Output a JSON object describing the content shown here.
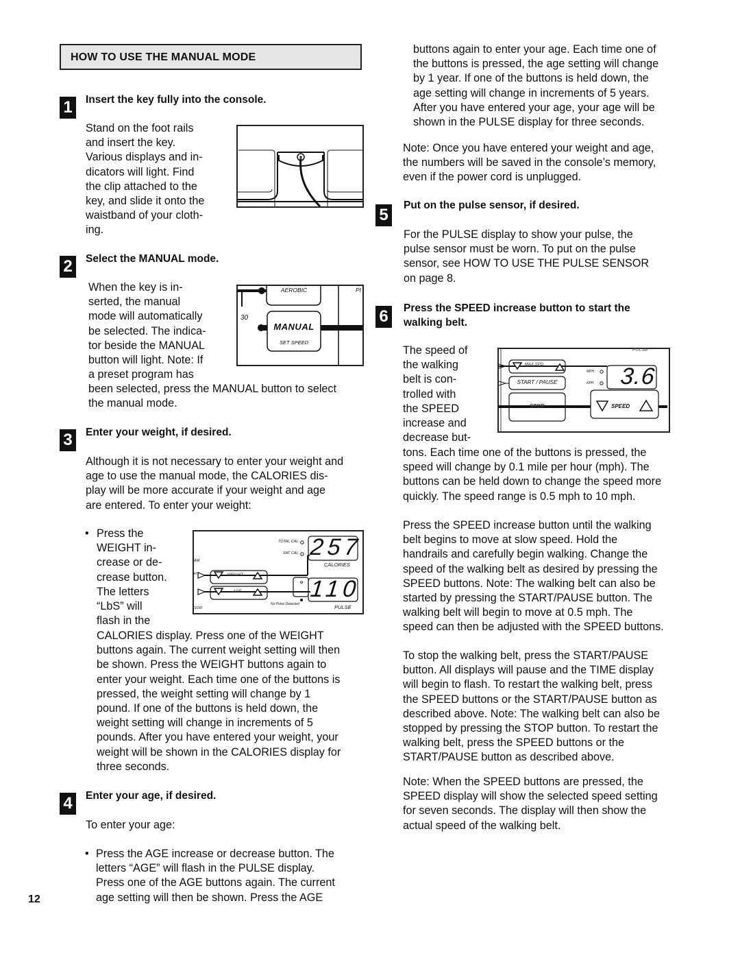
{
  "section": {
    "title": "HOW TO USE THE MANUAL MODE"
  },
  "page_number": "12",
  "steps": [
    {
      "number": "1",
      "title": "Insert the key fully into the console.",
      "body": "Stand on the foot rails\nand insert the key.\nVarious displays and in-\ndicators will light. Find\nthe clip attached to the\nkey, and slide it onto the\nwaistband of your cloth-\ning."
    },
    {
      "number": "2",
      "title": "Select the MANUAL mode.",
      "body_wrapped": "When the key is in-\nserted, the manual\nmode will automatically\nbe selected. The indica-\ntor beside the MANUAL\nbutton will light. Note: If\na preset program has",
      "body_full": "been selected, press the MANUAL button to select\nthe manual mode."
    },
    {
      "number": "3",
      "title": "Enter your weight, if desired.",
      "intro": "Although it is not necessary to enter your weight and\nage to use the manual mode, the CALORIES dis-\nplay will be more accurate if your weight and age\nare entered. To enter your weight:",
      "bullet_wrapped": "Press the\nWEIGHT in-\ncrease or de-\ncrease button.\nThe letters\n“LbS” will\nflash in the",
      "bullet_full": "CALORIES display. Press one of the WEIGHT\nbuttons again. The current weight setting will then\nbe shown. Press the WEIGHT buttons again to\nenter your weight. Each time one of the buttons is\npressed, the weight setting will change by 1\npound. If one of the buttons is held down, the\nweight setting will change in increments of 5\npounds. After you have entered your weight, your\nweight will be shown in the CALORIES display for\nthree seconds."
    },
    {
      "number": "4",
      "title": "Enter your age, if desired.",
      "intro": "To enter your age:",
      "bullet": "Press the AGE increase or decrease button. The\nletters “AGE” will flash in the PULSE display.\nPress one of the AGE buttons again. The current\nage setting will then be shown. Press the AGE",
      "continued": "buttons again to enter your age. Each time one of\nthe buttons is pressed, the age setting will change\nby 1 year. If one of the buttons is held down, the\nage setting will change in increments of 5 years.\nAfter you have entered your age, your age will be\nshown in the PULSE display for three seconds.",
      "note": "Note: Once you have entered your weight and age,\nthe numbers will be saved in the console’s memory,\neven if the power cord is unplugged."
    },
    {
      "number": "5",
      "title": "Put on the pulse sensor, if desired.",
      "body": "For the PULSE display to show your pulse, the\npulse sensor must be worn. To put on the pulse\nsensor, see HOW TO USE THE PULSE SENSOR\non page 8."
    },
    {
      "number": "6",
      "title": "Press the SPEED increase button to start the\nwalking belt.",
      "body_wrapped": "The speed of\nthe walking\nbelt is con-\ntrolled with\nthe SPEED\nincrease and\ndecrease but-",
      "body_full": "tons. Each time one of the buttons is pressed, the\nspeed will change by 0.1 mile per hour (mph). The\nbuttons can be held down to change the speed more\nquickly. The speed range is 0.5 mph to 10 mph.",
      "para2": "Press the SPEED increase button until the walking\nbelt begins to move at slow speed. Hold the\nhandrails and carefully begin walking. Change the\nspeed of the walking belt as desired by pressing the\nSPEED buttons. Note: The walking belt can also be\nstarted by pressing the START/PAUSE button. The\nwalking belt will begin to move at 0.5 mph. The\nspeed can then be adjusted with the SPEED buttons.",
      "para3": "To stop the walking belt, press the START/PAUSE\nbutton. All displays will pause and the TIME display\nwill begin to flash. To restart the walking belt, press\nthe SPEED buttons or the START/PAUSE button as\ndescribed above. Note: The walking belt can also be\nstopped by pressing the STOP button. To restart the\nwalking belt, press the SPEED buttons or the\nSTART/PAUSE button as described above.",
      "para4": "Note: When the SPEED buttons are pressed, the\nSPEED display will show the selected speed setting\nfor seven seconds. The display will then show the\nactual speed of the walking belt."
    }
  ],
  "figures": {
    "manual_panel": {
      "aerobic_label": "AEROBIC",
      "partial_label": "PI",
      "level_label": "30",
      "manual_label": "MANUAL",
      "sub_label": "SET SPEED"
    },
    "calories_panel": {
      "total_cal_label": "TOTAL CAL.",
      "fat_cal_label": "FAT CAL.",
      "calories_value": "257",
      "calories_label": "CALORIES",
      "weight_label": "WEIGHT",
      "age_label": "AGE",
      "pulse_value": "110",
      "pulse_label": "PULSE",
      "no_pulse_label": "No Pulse Detected",
      "edge_label_1": "AM",
      "edge_label_2": "HT",
      "edge_label_3": "SOR"
    },
    "speed_panel": {
      "top_label": "PULSE",
      "max_spd_label": "MAX.SPD.",
      "start_pause_label": "START / PAUSE",
      "stop_label": "STOP",
      "mph_label": "MPH",
      "kph_label": "KPH",
      "speed_value": "3.6",
      "speed_label": "SPEED"
    }
  }
}
